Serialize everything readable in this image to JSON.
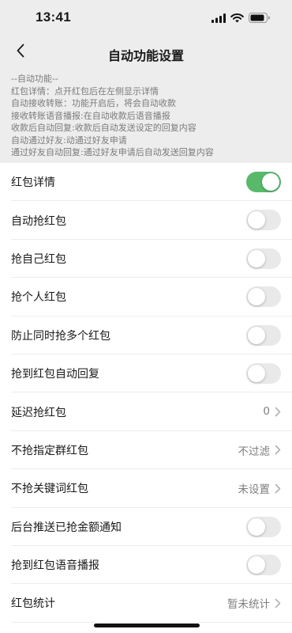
{
  "status": {
    "time": "13:41"
  },
  "nav": {
    "title": "自动功能设置"
  },
  "notes": [
    "--自动功能--",
    "红包详情：点开红包后在左侧显示详情",
    "自动接收转账：功能开启后，将会自动收款",
    "接收转账语音播报:在自动收款后语音播报",
    "收款后自动回复:收款后自动发送设定的回复内容",
    "自动通过好友:动通过好友申请",
    "通过好友自动回复:通过好友申请后自动发送回复内容"
  ],
  "settings": [
    {
      "label": "红包详情",
      "type": "toggle",
      "on": true
    },
    {
      "label": "自动抢红包",
      "type": "toggle",
      "on": false
    },
    {
      "label": "抢自己红包",
      "type": "toggle",
      "on": false
    },
    {
      "label": "抢个人红包",
      "type": "toggle",
      "on": false
    },
    {
      "label": "防止同时抢多个红包",
      "type": "toggle",
      "on": false
    },
    {
      "label": "抢到红包自动回复",
      "type": "toggle",
      "on": false
    },
    {
      "label": "延迟抢红包",
      "type": "value",
      "value": "0"
    },
    {
      "label": "不抢指定群红包",
      "type": "value",
      "value": "不过滤"
    },
    {
      "label": "不抢关键词红包",
      "type": "value",
      "value": "未设置"
    },
    {
      "label": "后台推送已抢金额通知",
      "type": "toggle",
      "on": false
    },
    {
      "label": "抢到红包语音播报",
      "type": "toggle",
      "on": false
    },
    {
      "label": "红包统计",
      "type": "value",
      "value": "暂未统计"
    }
  ],
  "colors": {
    "toggle_on": "#59b96b",
    "toggle_off": "#e9e9ea",
    "background": "#ededed"
  },
  "icons": [
    "back-arrow-icon",
    "signal-icon",
    "wifi-icon",
    "battery-icon",
    "chevron-right-icon"
  ]
}
